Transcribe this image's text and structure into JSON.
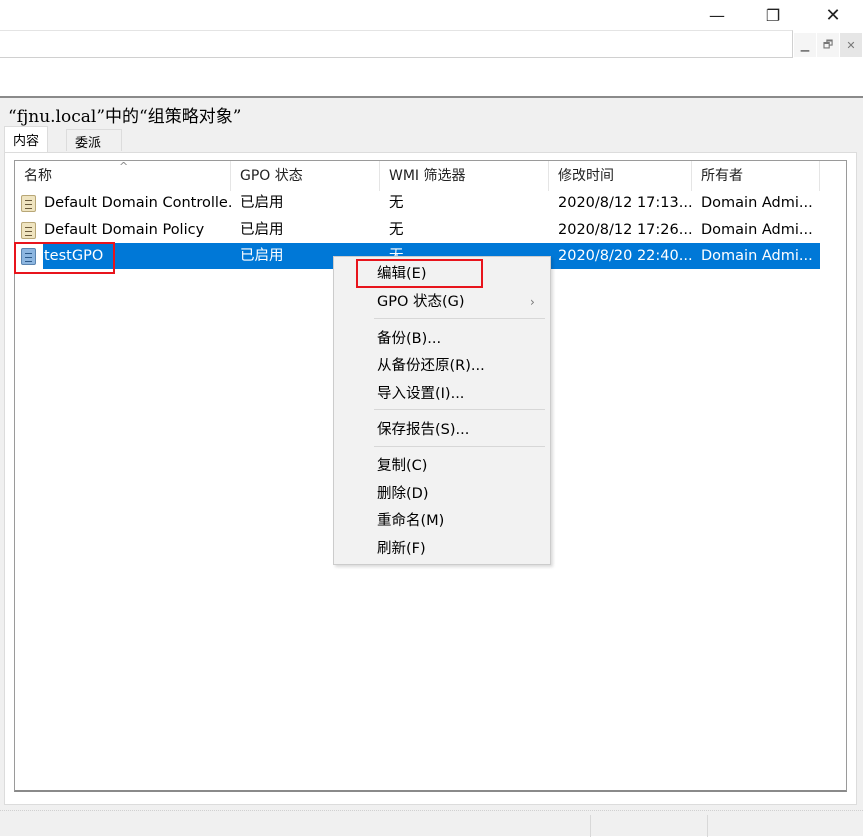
{
  "window": {
    "minimize_icon": "minimize-icon",
    "restore_icon": "restore-icon",
    "close_icon": "close-icon"
  },
  "panel": {
    "title": "“fjnu.local”中的“组策略对象”",
    "tabs": [
      {
        "label": "内容"
      },
      {
        "label": "委派"
      }
    ]
  },
  "table": {
    "columns": [
      "名称",
      "GPO 状态",
      "WMI 筛选器",
      "修改时间",
      "所有者"
    ],
    "sort_indicator": "^",
    "rows": [
      {
        "name": "Default Domain Controlle...",
        "status": "已启用",
        "wmi": "无",
        "modified": "2020/8/12 17:13...",
        "owner": "Domain Admi..."
      },
      {
        "name": "Default Domain Policy",
        "status": "已启用",
        "wmi": "无",
        "modified": "2020/8/12 17:26...",
        "owner": "Domain Admi..."
      },
      {
        "name": "testGPO",
        "status": "已启用",
        "wmi": "无",
        "modified": "2020/8/20 22:40...",
        "owner": "Domain Admi...",
        "selected": true
      }
    ]
  },
  "context_menu": {
    "items": [
      "编辑(E)",
      "GPO 状态(G)",
      "备份(B)...",
      "从备份还原(R)...",
      "导入设置(I)...",
      "保存报告(S)...",
      "复制(C)",
      "删除(D)",
      "重命名(M)",
      "刷新(F)"
    ],
    "submenu_arrow": "›"
  },
  "colors": {
    "selection": "#0078d7",
    "highlight_box": "#e8141c"
  }
}
